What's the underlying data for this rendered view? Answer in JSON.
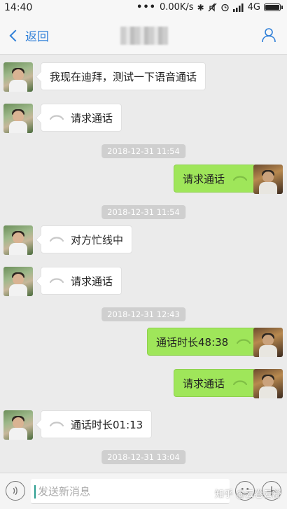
{
  "status_bar": {
    "time": "14:40",
    "dots": "•••",
    "speed": "0.00K/s",
    "bluetooth": "✱",
    "network": "4G"
  },
  "header": {
    "back_label": "返回"
  },
  "messages": [
    {
      "type": "text",
      "side": "left",
      "text": "我现在迪拜，测试一下语音通话"
    },
    {
      "type": "call",
      "side": "left",
      "text": "请求通话"
    },
    {
      "type": "time",
      "text": "2018-12-31 11:54"
    },
    {
      "type": "call",
      "side": "right",
      "text": "请求通话"
    },
    {
      "type": "time",
      "text": "2018-12-31 11:54"
    },
    {
      "type": "call",
      "side": "left",
      "text": "对方忙线中"
    },
    {
      "type": "call",
      "side": "left",
      "text": "请求通话"
    },
    {
      "type": "time",
      "text": "2018-12-31 12:43"
    },
    {
      "type": "call",
      "side": "right",
      "text": "通话时长48:38"
    },
    {
      "type": "call",
      "side": "right",
      "text": "请求通话"
    },
    {
      "type": "call",
      "side": "left",
      "text": "通话时长01:13"
    },
    {
      "type": "time",
      "text": "2018-12-31 13:04"
    }
  ],
  "input_bar": {
    "placeholder": "发送新消息"
  },
  "watermark": "知乎 @云卷云舒",
  "colors": {
    "accent": "#2f7fd8",
    "my_bubble": "#9fe65a",
    "background": "#ebebeb"
  }
}
